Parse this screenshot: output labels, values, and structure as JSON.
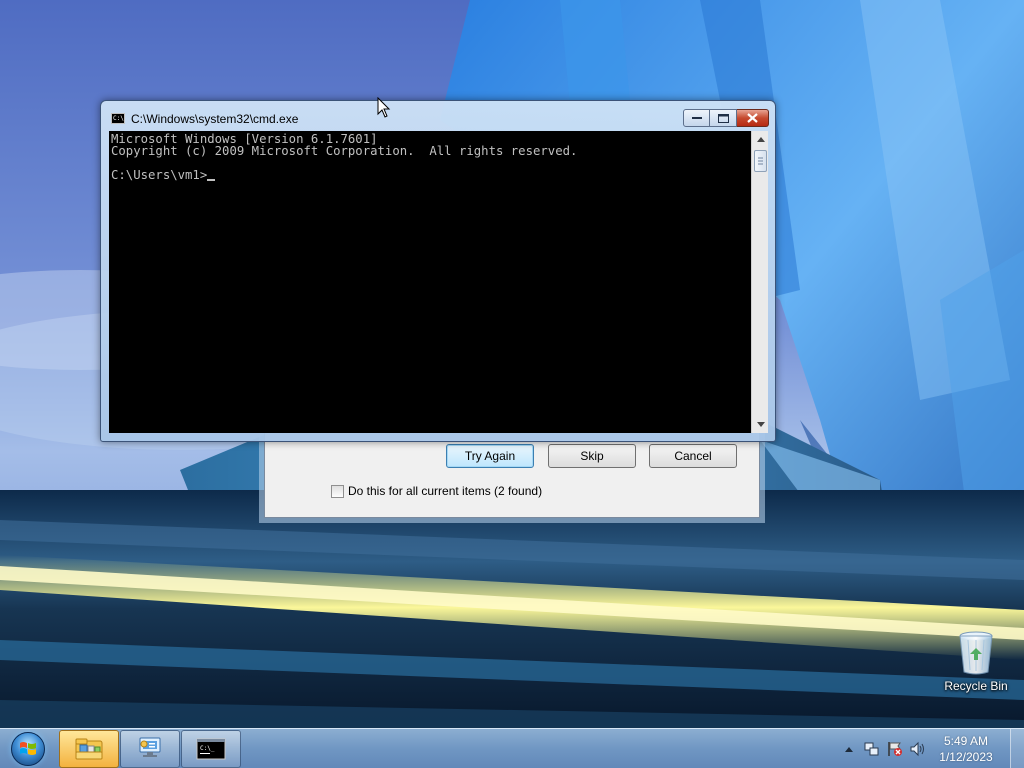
{
  "cmd_window": {
    "title": "C:\\Windows\\system32\\cmd.exe",
    "icon_text": "C:\\",
    "console_lines": [
      "Microsoft Windows [Version 6.1.7601]",
      "Copyright (c) 2009 Microsoft Corporation.  All rights reserved.",
      "",
      "C:\\Users\\vm1>"
    ]
  },
  "dialog": {
    "try_again_label": "Try Again",
    "skip_label": "Skip",
    "cancel_label": "Cancel",
    "checkbox_label": "Do this for all current items (2 found)",
    "checkbox_checked": false
  },
  "desktop": {
    "icons": [
      {
        "label": "Recycle Bin",
        "icon": "recycle-bin-icon"
      }
    ]
  },
  "taskbar": {
    "start_icon": "windows-orb-icon",
    "pinned": [
      {
        "name": "Windows Explorer",
        "icon": "folder-library-icon"
      },
      {
        "name": "Network",
        "icon": "network-control-icon"
      },
      {
        "name": "Command Prompt",
        "icon": "cmd-icon"
      }
    ],
    "clock": {
      "time": "5:49 AM",
      "date": "1/12/2023"
    },
    "tray_icons": [
      "show-hidden-icons-arrow",
      "network-icon",
      "action-center-icon",
      "volume-icon"
    ]
  }
}
